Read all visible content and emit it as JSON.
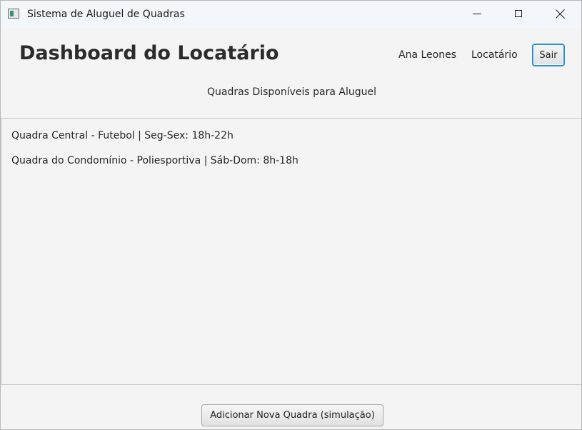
{
  "window": {
    "title": "Sistema de Aluguel de Quadras",
    "app_icon": "java-app-icon",
    "controls": {
      "minimize_icon": "minimize-icon",
      "maximize_icon": "maximize-icon",
      "close_icon": "close-icon"
    }
  },
  "header": {
    "title": "Dashboard do Locatário",
    "user_name": "Ana Leones",
    "user_role": "Locatário",
    "logout_label": "Sair",
    "logout_focus_color": "#2b8fd8"
  },
  "main": {
    "subtitle": "Quadras Disponíveis para Aluguel",
    "courts": [
      "Quadra Central - Futebol | Seg-Sex: 18h-22h",
      "Quadra do Condomínio - Poliesportiva | Sáb-Dom: 8h-18h"
    ]
  },
  "footer": {
    "add_button_label": "Adicionar Nova Quadra (simulação)"
  }
}
